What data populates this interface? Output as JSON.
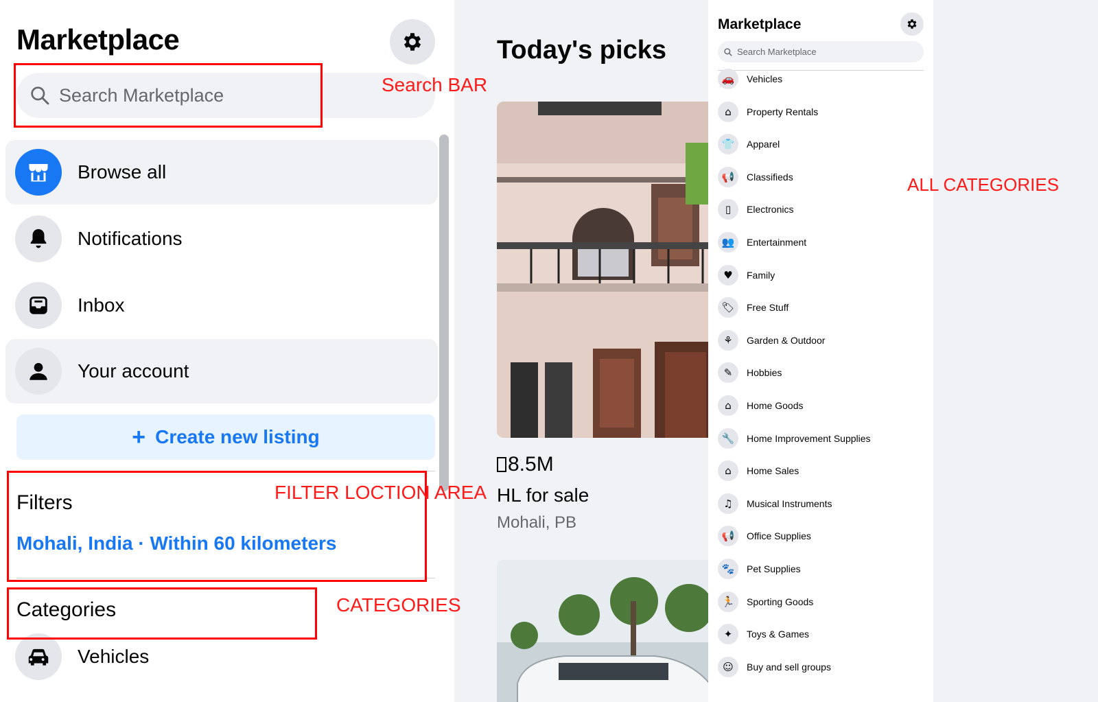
{
  "left": {
    "title": "Marketplace",
    "search_placeholder": "Search Marketplace",
    "nav": [
      {
        "label": "Browse all",
        "icon": "storefront-icon",
        "active": true
      },
      {
        "label": "Notifications",
        "icon": "bell-icon"
      },
      {
        "label": "Inbox",
        "icon": "inbox-icon"
      },
      {
        "label": "Your account",
        "icon": "person-icon"
      }
    ],
    "create_listing": "Create new listing",
    "filters_heading": "Filters",
    "location": "Mohali, India · Within 60 kilometers",
    "categories_heading": "Categories",
    "first_category": "Vehicles"
  },
  "annotations": {
    "search": "Search BAR",
    "filter": "FILTER LOCTION AREA",
    "categories": "CATEGORIES",
    "all_categories": "ALL CATEGORIES"
  },
  "feed": {
    "title": "Today's picks",
    "listing": {
      "price": "8.5M",
      "title": "HL for sale",
      "location": "Mohali, PB"
    }
  },
  "right": {
    "title": "Marketplace",
    "search_placeholder": "Search Marketplace",
    "categories": [
      {
        "label": "Vehicles",
        "icon": "car-icon"
      },
      {
        "label": "Property Rentals",
        "icon": "house-tag-icon"
      },
      {
        "label": "Apparel",
        "icon": "shirt-icon"
      },
      {
        "label": "Classifieds",
        "icon": "megaphone-icon"
      },
      {
        "label": "Electronics",
        "icon": "phone-icon"
      },
      {
        "label": "Entertainment",
        "icon": "people-icon"
      },
      {
        "label": "Family",
        "icon": "heart-icon"
      },
      {
        "label": "Free Stuff",
        "icon": "tag-icon"
      },
      {
        "label": "Garden & Outdoor",
        "icon": "plant-icon"
      },
      {
        "label": "Hobbies",
        "icon": "brush-icon"
      },
      {
        "label": "Home Goods",
        "icon": "home-icon"
      },
      {
        "label": "Home Improvement Supplies",
        "icon": "wrench-icon"
      },
      {
        "label": "Home Sales",
        "icon": "house-tag-icon"
      },
      {
        "label": "Musical Instruments",
        "icon": "guitar-icon"
      },
      {
        "label": "Office Supplies",
        "icon": "megaphone-icon"
      },
      {
        "label": "Pet Supplies",
        "icon": "paw-icon"
      },
      {
        "label": "Sporting Goods",
        "icon": "runner-icon"
      },
      {
        "label": "Toys & Games",
        "icon": "puzzle-icon"
      },
      {
        "label": "Buy and sell groups",
        "icon": "group-icon"
      }
    ]
  },
  "colors": {
    "accent": "#1877f2",
    "annotation": "#ff0000",
    "muted": "#65676b",
    "bg": "#f0f2f5"
  }
}
